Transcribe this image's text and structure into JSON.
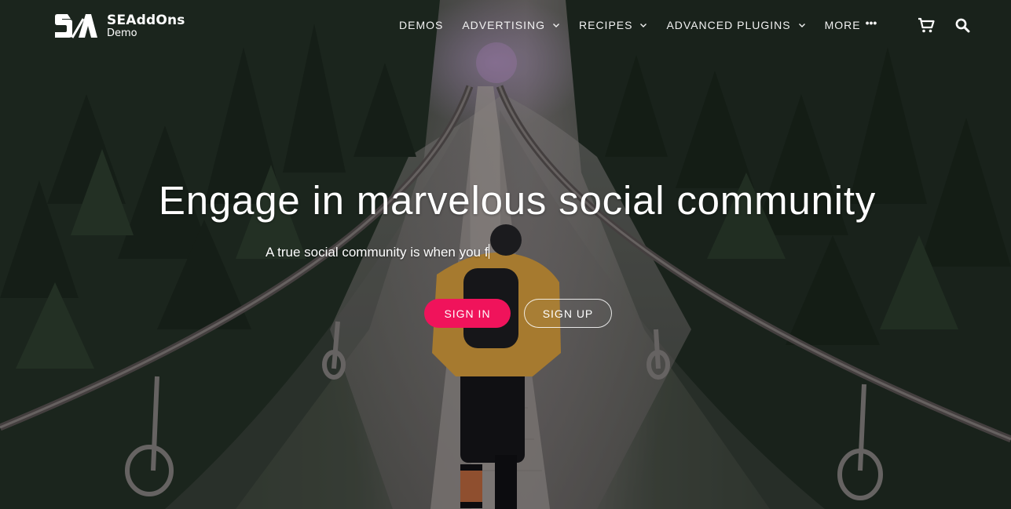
{
  "brand": {
    "name": "SEAddOns",
    "sub": "Demo",
    "mark_letters": "SA"
  },
  "nav": {
    "items": [
      {
        "label": "DEMOS",
        "dropdown": false
      },
      {
        "label": "ADVERTISING",
        "dropdown": true
      },
      {
        "label": "RECIPES",
        "dropdown": true
      },
      {
        "label": "ADVANCED PLUGINS",
        "dropdown": true
      },
      {
        "label": "MORE",
        "dropdown": false,
        "more": true
      }
    ],
    "more_glyph": "•••"
  },
  "icons": {
    "cart": "cart-icon",
    "search": "search-icon"
  },
  "hero": {
    "headline": "Engage in marvelous social community",
    "subline": "A true social community is when you f",
    "signin_label": "SIGN IN",
    "signup_label": "SIGN UP"
  },
  "colors": {
    "accent": "#f0135b"
  }
}
